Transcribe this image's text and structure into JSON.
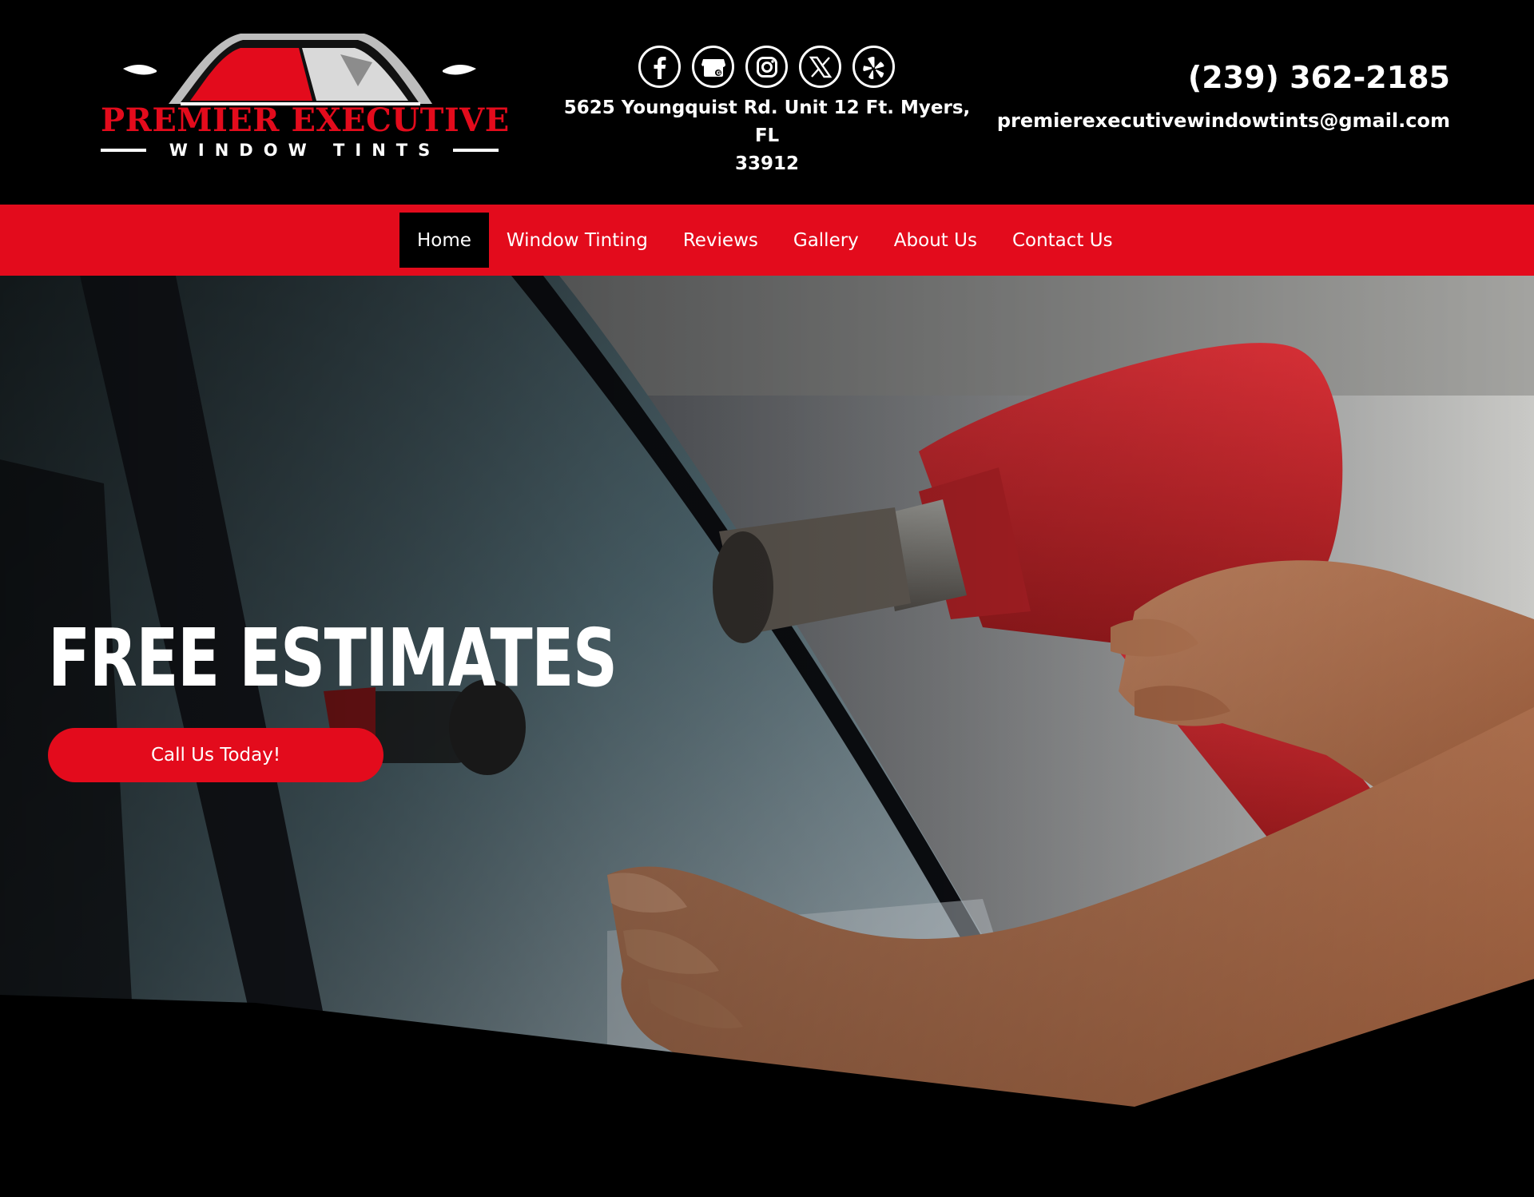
{
  "brand": {
    "name_line1": "PREMIER EXECUTIVE",
    "name_line2": "WINDOW TINTS",
    "accent_color": "#e30b1c"
  },
  "header": {
    "socials": [
      {
        "icon": "facebook-icon"
      },
      {
        "icon": "google-business-icon"
      },
      {
        "icon": "instagram-icon"
      },
      {
        "icon": "x-twitter-icon"
      },
      {
        "icon": "yelp-icon"
      }
    ],
    "address_line1": "5625 Youngquist Rd. Unit 12 Ft. Myers, FL",
    "address_line2": "33912",
    "phone": "(239) 362-2185",
    "email": "premierexecutivewindowtints@gmail.com"
  },
  "nav": {
    "items": [
      {
        "label": "Home",
        "active": true
      },
      {
        "label": "Window Tinting",
        "active": false
      },
      {
        "label": "Reviews",
        "active": false
      },
      {
        "label": "Gallery",
        "active": false
      },
      {
        "label": "About Us",
        "active": false
      },
      {
        "label": "Contact Us",
        "active": false
      }
    ]
  },
  "hero": {
    "title": "FREE ESTIMATES",
    "cta_label": "Call Us Today!"
  }
}
